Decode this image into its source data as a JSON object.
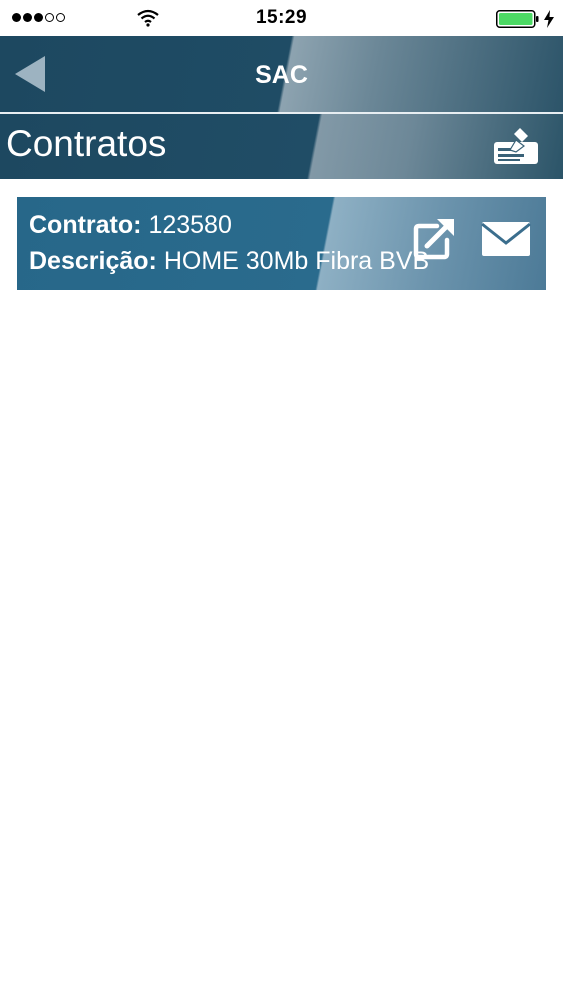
{
  "status_bar": {
    "time": "15:29",
    "signal_strength": 3,
    "signal_max": 5,
    "battery_level": 1.0,
    "charging": true,
    "icons": [
      "signal-dots-icon",
      "wifi-icon",
      "battery-icon",
      "charging-bolt-icon"
    ]
  },
  "nav": {
    "title": "SAC",
    "back_icon": "back-triangle-icon"
  },
  "section": {
    "title": "Contratos",
    "edit_icon": "sign-document-icon"
  },
  "contract": {
    "contract_label": "Contrato:",
    "contract_number": "123580",
    "description_label": "Descrição:",
    "description_value": "HOME 30Mb Fibra BVB",
    "share_icon": "open-external-icon",
    "mail_icon": "mail-icon"
  },
  "colors": {
    "nav_bg": "#1d4860",
    "card_bg": "#276789",
    "text": "#ffffff"
  }
}
